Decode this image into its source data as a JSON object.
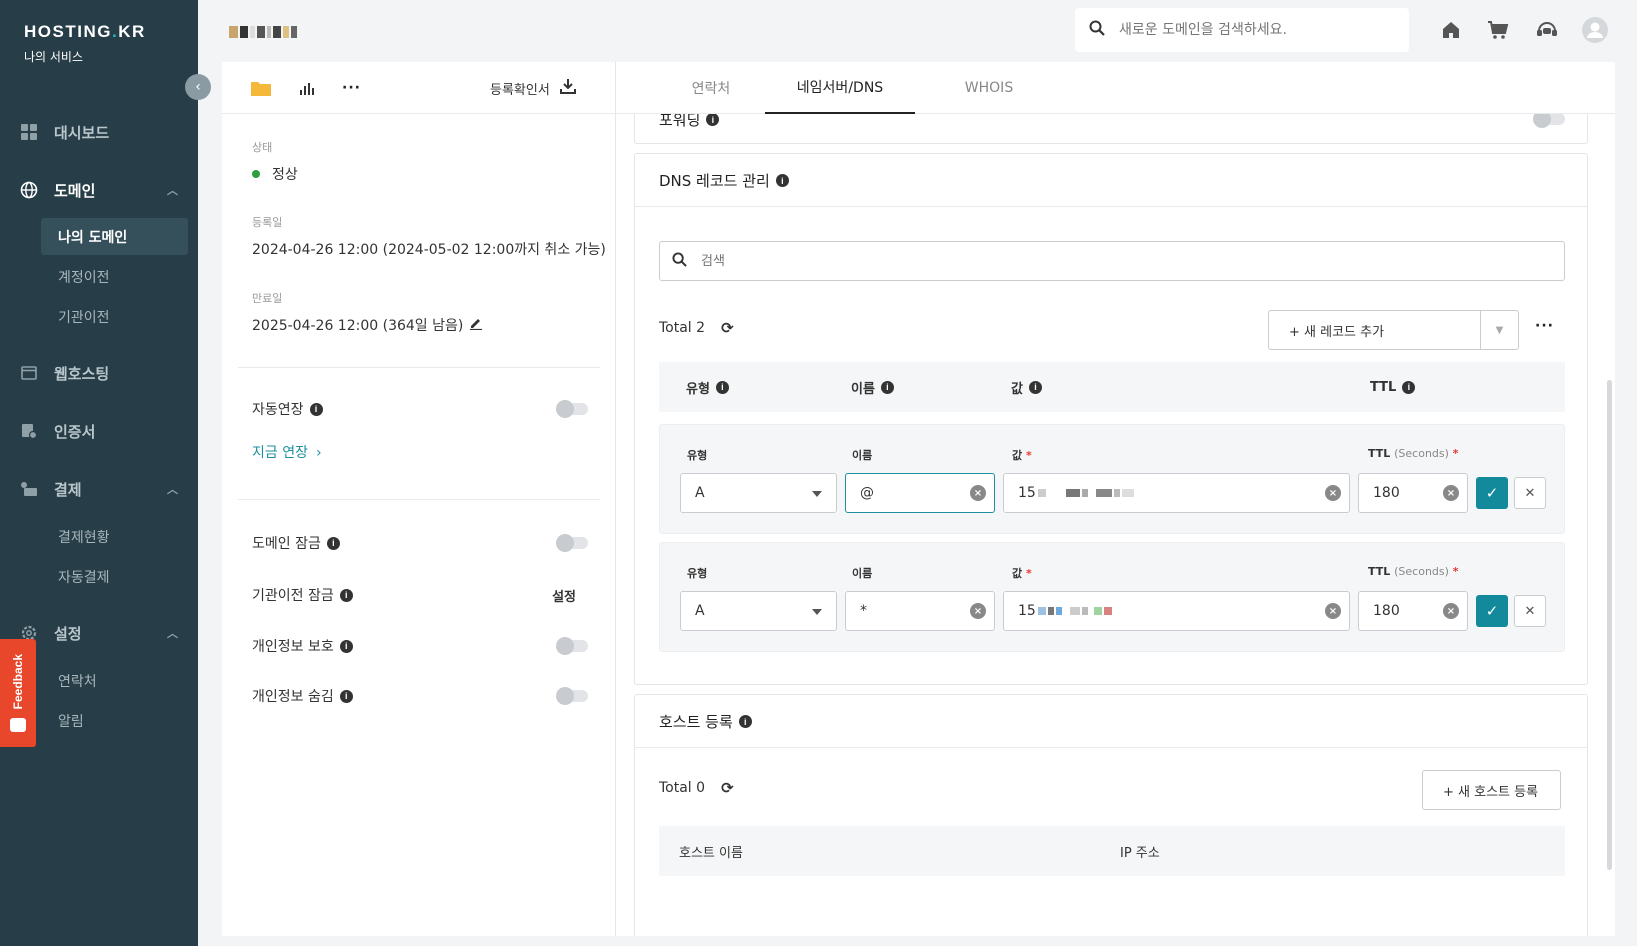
{
  "sidebar": {
    "brand": "HOSTING",
    "brand_dot": ".",
    "brand_suffix": "KR",
    "subtitle": "나의 서비스",
    "items": {
      "dashboard": "대시보드",
      "domain": "도메인",
      "my_domain": "나의 도메인",
      "account_transfer": "계정이전",
      "registrar_transfer": "기관이전",
      "web_hosting": "웹호스팅",
      "certificate": "인증서",
      "payment": "결제",
      "payment_status": "결제현황",
      "auto_payment": "자동결제",
      "settings": "설정",
      "contacts": "연락처",
      "alerts": "알림"
    },
    "feedback": "Feedback"
  },
  "header": {
    "search_placeholder": "새로운 도메인을 검색하세요."
  },
  "left": {
    "toolbar": {
      "certificate_label": "등록확인서"
    },
    "status_label": "상태",
    "status_value": "정상",
    "registered_label": "등록일",
    "registered_value": "2024-04-26 12:00 (2024-05-02 12:00까지 취소 가능)",
    "expiry_label": "만료일",
    "expiry_value": "2025-04-26 12:00 (364일 남음)",
    "auto_renew": "자동연장",
    "renew_now": "지금 연장",
    "domain_lock": "도메인 잠금",
    "registrar_lock": "기관이전 잠금",
    "registrar_lock_action": "설정",
    "privacy_protect": "개인정보 보호",
    "privacy_hide": "개인정보 숨김"
  },
  "tabs": {
    "contact": "연락처",
    "nameserver": "네임서버/DNS",
    "whois": "WHOIS"
  },
  "forwarding": {
    "title": "포워딩"
  },
  "dns": {
    "title": "DNS 레코드 관리",
    "search_placeholder": "검색",
    "total": "Total 2",
    "add_button": "+ 새 레코드 추가",
    "columns": {
      "type": "유형",
      "name": "이름",
      "value": "값",
      "ttl": "TTL"
    },
    "field_labels": {
      "type": "유형",
      "name": "이름",
      "value": "값",
      "ttl": "TTL",
      "seconds": "(Seconds)",
      "required": "*"
    },
    "records": [
      {
        "type": "A",
        "name": "@",
        "value_prefix": "15",
        "ttl": "180"
      },
      {
        "type": "A",
        "name": "*",
        "value_prefix": "15",
        "ttl": "180"
      }
    ]
  },
  "host": {
    "title": "호스트 등록",
    "total": "Total 0",
    "add_button": "+ 새 호스트 등록",
    "columns": {
      "host_name": "호스트 이름",
      "ip": "IP 주소"
    }
  },
  "colors": {
    "sidebar": "#273d47",
    "accent": "#138a9b",
    "feedback": "#e8472b",
    "status_ok": "#2e9e3e"
  }
}
